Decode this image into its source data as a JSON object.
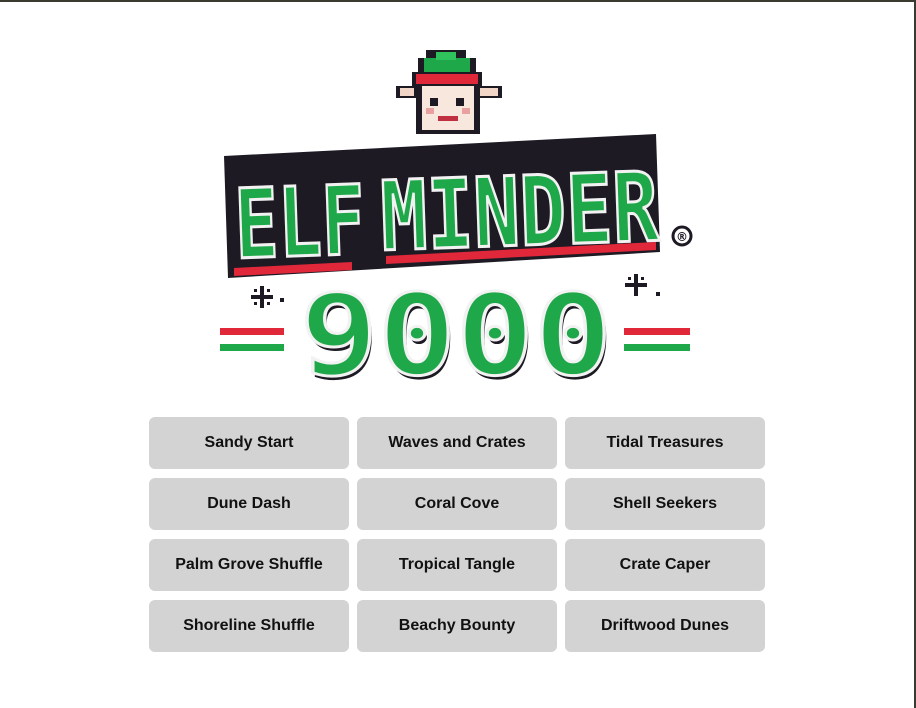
{
  "logo": {
    "title_word_1": "ELF",
    "title_word_2": "MINDER",
    "title_number": "9000",
    "registered_mark": "®"
  },
  "levels": [
    "Sandy Start",
    "Waves and Crates",
    "Tidal Treasures",
    "Dune Dash",
    "Coral Cove",
    "Shell Seekers",
    "Palm Grove Shuffle",
    "Tropical Tangle",
    "Crate Caper",
    "Shoreline Shuffle",
    "Beachy Bounty",
    "Driftwood Dunes"
  ],
  "colors": {
    "button_bg": "#d3d3d3",
    "logo_green": "#1fa84a",
    "logo_red": "#e0283a",
    "logo_outline": "#1e1a24",
    "logo_face": "#ffffff"
  }
}
